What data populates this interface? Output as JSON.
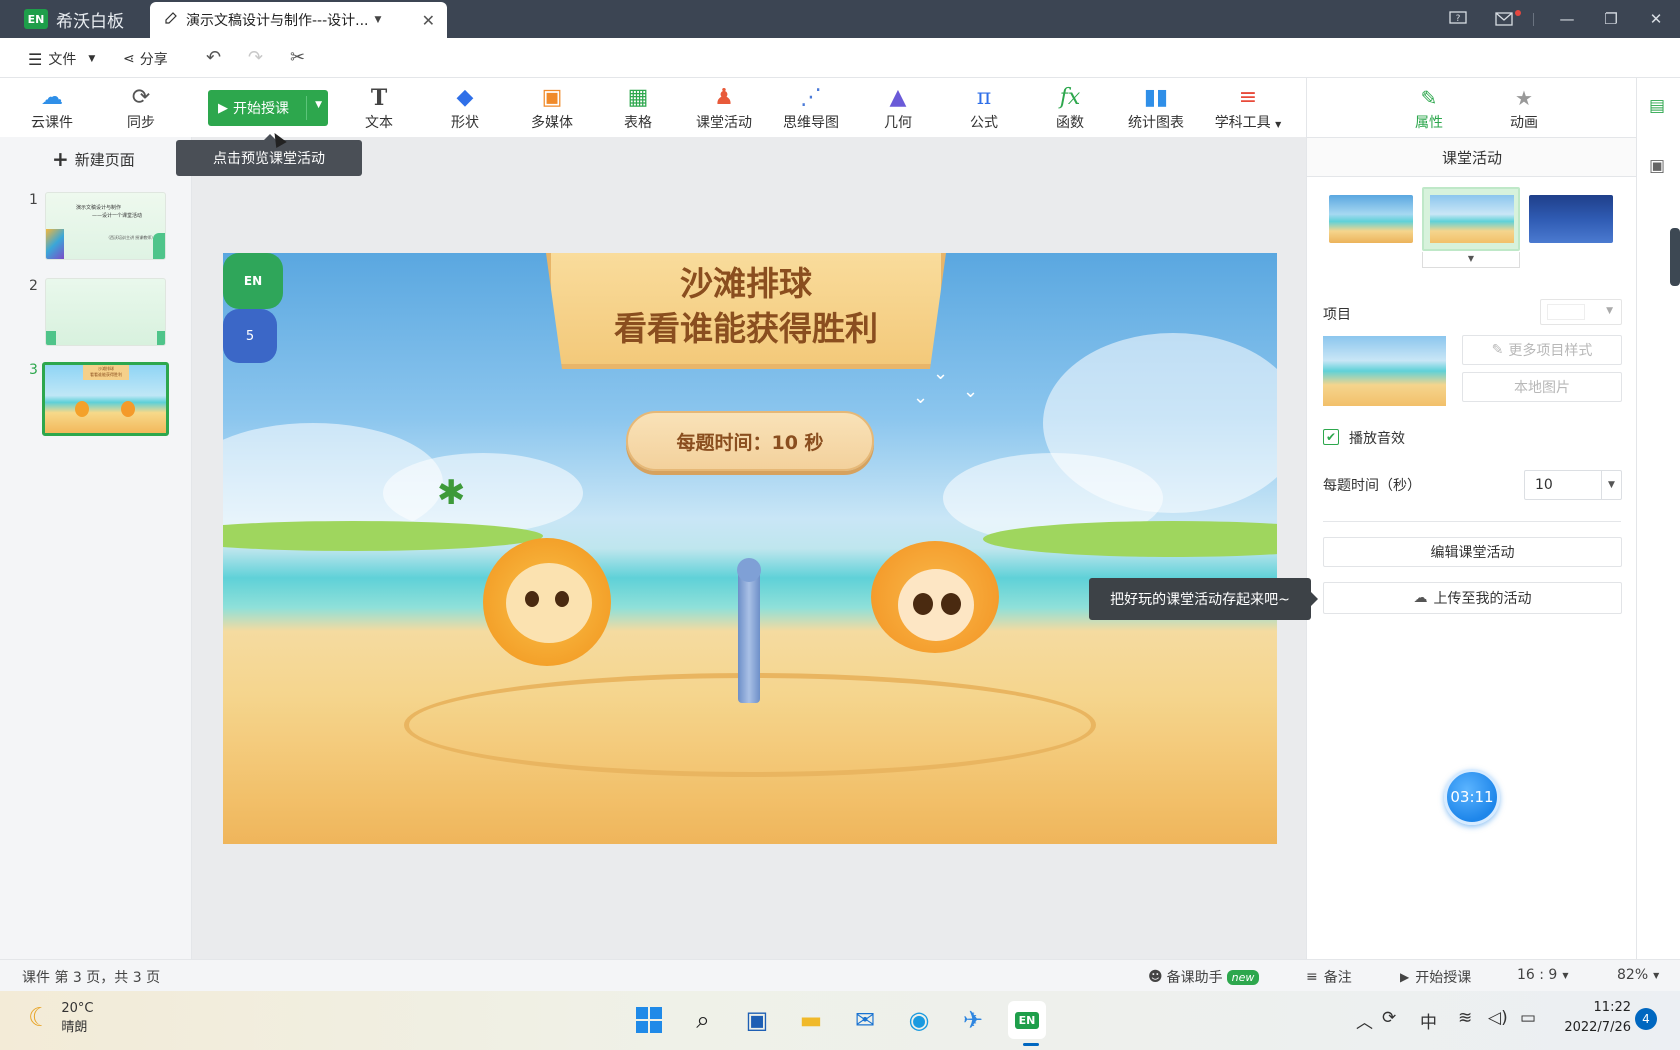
{
  "titlebar": {
    "app_logo": "EN",
    "app_name": "希沃白板",
    "doc_tab_title": "演示文稿设计与制作---设计...",
    "icons": [
      "help-icon",
      "mail-icon",
      "minimize-icon",
      "restore-icon",
      "close-icon"
    ]
  },
  "menubar": {
    "file_label": "文件",
    "share_label": "分享"
  },
  "ribbon": {
    "cloud_label": "云课件",
    "sync_label": "同步",
    "start_label": "开始授课",
    "text_label": "文本",
    "shape_label": "形状",
    "media_label": "多媒体",
    "table_label": "表格",
    "activity_label": "课堂活动",
    "mindmap_label": "思维导图",
    "geometry_label": "几何",
    "formula_label": "公式",
    "function_label": "函数",
    "chart_label": "统计图表",
    "subject_label": "学科工具",
    "start_tooltip": "点击预览课堂活动"
  },
  "leftpanel": {
    "new_page_label": "新建页面",
    "thumbs": [
      {
        "num": "1",
        "line1": "演示文稿设计与制作",
        "line2": "——设计一个课堂活动",
        "line3": "（西沃培训主讲 授课教师）"
      },
      {
        "num": "2"
      },
      {
        "num": "3",
        "line1": "沙滩排球",
        "line2": "看看谁能获得胜利"
      }
    ]
  },
  "slide": {
    "title_line1": "沙滩排球",
    "title_line2": "看看谁能获得胜利",
    "timer_text": "每题时间：10 秒",
    "lion_shirt": "EN",
    "monkey_shirt": "5"
  },
  "rightpanel": {
    "tab_properties": "属性",
    "tab_animation": "动画",
    "section_title": "课堂活动",
    "item_label": "项目",
    "more_styles": "更多项目样式",
    "local_image": "本地图片",
    "sound_label": "播放音效",
    "sound_checked": true,
    "time_label": "每题时间（秒）",
    "time_value": "10",
    "edit_button": "编辑课堂活动",
    "upload_button": "上传至我的活动",
    "save_tooltip": "把好玩的课堂活动存起来吧~",
    "timer_bubble": "03:11"
  },
  "statusbar": {
    "page_info": "课件 第 3 页，共 3 页",
    "assistant_label": "备课助手",
    "new_badge": "new",
    "notes_label": "备注",
    "start_label": "开始授课",
    "ratio_label": "16 : 9",
    "zoom_label": "82%"
  },
  "taskbar": {
    "temperature": "20°C",
    "weather": "晴朗",
    "ime_label": "中",
    "time": "11:22",
    "date": "2022/7/26",
    "notification_count": "4"
  },
  "colors": {
    "accent_green": "#2da74d",
    "titlebar_bg": "#3c4553",
    "taskbar_blue": "#0067c0"
  }
}
